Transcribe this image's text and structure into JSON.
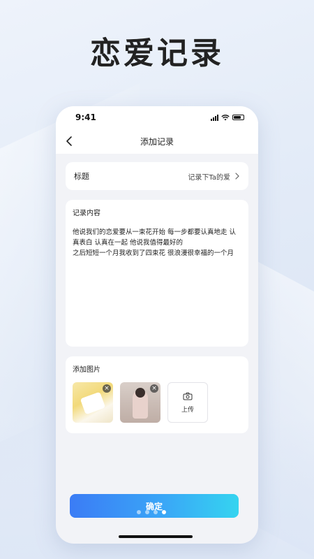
{
  "headline": "恋爱记录",
  "status_bar": {
    "time": "9:41"
  },
  "nav": {
    "title": "添加记录"
  },
  "form": {
    "title_label": "标题",
    "title_value": "记录下Ta的爱",
    "content_label": "记录内容",
    "content_text": "他说我们的恋爱要从一束花开始 每一步都要认真地走 认真表白 认真在一起 他说我值得最好的\n之后短短一个月我收到了四束花 很浪漫很幸福的一个月",
    "photos_label": "添加图片",
    "upload_label": "上传",
    "photo_close": "×"
  },
  "confirm_label": "确定",
  "pager": {
    "total": 4,
    "active": 4
  },
  "icons": [
    "back-icon",
    "chevron-right-icon",
    "camera-icon",
    "close-icon",
    "signal-icon",
    "wifi-icon",
    "battery-icon"
  ],
  "colors": {
    "accent_start": "#3b7cf5",
    "accent_end": "#35d4f0"
  }
}
